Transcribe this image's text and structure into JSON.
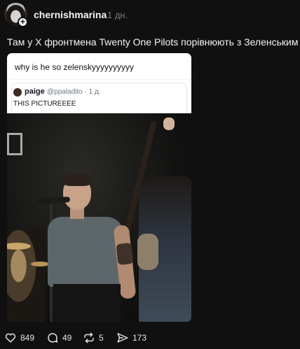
{
  "post": {
    "author": "chernishmarina",
    "time": "1 дн.",
    "text": "Там у Х фронтмена Twenty One Pilots порівнюють з Зеленським",
    "text_emoji_icon": "moai-emoji-icon"
  },
  "quote": {
    "text": "why is he so zelenskyyyyyyyyyy",
    "inner": {
      "name": "paige",
      "handle": "@ppaladito · 1 д.",
      "body": "THIS PICTUREEEE"
    }
  },
  "actions": {
    "likes": "849",
    "comments": "49",
    "reposts": "5",
    "shares": "173"
  },
  "colors": {
    "background": "#101010",
    "text": "#f3f5f7",
    "muted": "#777777",
    "card": "#ffffff"
  }
}
